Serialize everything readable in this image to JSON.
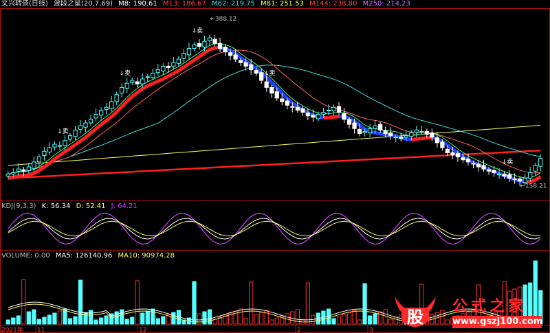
{
  "header": {
    "title": "文兴转债(日线)",
    "indicator": "波段之星(20,7,69)",
    "ma": [
      {
        "label": "M8: 190.61",
        "color": "#ffffff"
      },
      {
        "label": "M13: 186.67",
        "color": "#ff4040"
      },
      {
        "label": "M62: 219.75",
        "color": "#40e0e0"
      },
      {
        "label": "M81: 251.53",
        "color": "#ffff50"
      },
      {
        "label": "M144: 238.80",
        "color": "#ff4040"
      },
      {
        "label": "M250: 214.23",
        "color": "#d070ff"
      }
    ]
  },
  "kdj_header": {
    "name": "KDJ(9,3,3)",
    "k": "K: 56.34",
    "d": "D: 52.41",
    "j": "J: 64.21"
  },
  "volume_header": {
    "name": "VOLUME: 0.00",
    "ma5": "MA5: 126140.96",
    "ma10": "MA10: 90974.28"
  },
  "annotations": {
    "sell": "↓卖",
    "high": "←388.12",
    "low": "←158.21"
  },
  "date_labels": [
    "2021年",
    "11",
    "12",
    "2",
    "3"
  ],
  "watermark": {
    "logo_char": "股",
    "text": "公式之家",
    "url": "www.gszj100.com"
  },
  "colors": {
    "up": "#54ffff",
    "down": "#ffffff",
    "grid": "#b01010",
    "ribbon_up": "#ff2020",
    "ribbon_down": "#2040ff",
    "k": "#ffffff",
    "d": "#ffff60",
    "j": "#d040ff"
  },
  "chart_data": {
    "type": "candlestick",
    "title": "文兴转债(日线)",
    "series_close": [
      168,
      170,
      175,
      172,
      178,
      185,
      192,
      200,
      205,
      210,
      208,
      215,
      222,
      230,
      236,
      240,
      245,
      252,
      258,
      262,
      270,
      280,
      290,
      296,
      300,
      295,
      302,
      305,
      310,
      315,
      320,
      318,
      325,
      330,
      338,
      345,
      350,
      348,
      355,
      360,
      352,
      345,
      340,
      335,
      330,
      325,
      320,
      315,
      310,
      300,
      290,
      282,
      275,
      270,
      265,
      262,
      258,
      255,
      250,
      248,
      252,
      255,
      258,
      262,
      255,
      245,
      238,
      232,
      225,
      228,
      232,
      236,
      230,
      225,
      222,
      220,
      218,
      222,
      226,
      230,
      228,
      224,
      220,
      212,
      205,
      198,
      195,
      192,
      188,
      185,
      182,
      178,
      175,
      172,
      170,
      168,
      165,
      162,
      160,
      158,
      162,
      170,
      180,
      190
    ],
    "high_annotation": 388.12,
    "low_annotation": 158.21,
    "kdj": {
      "K": 56.34,
      "D": 52.41,
      "J": 64.21
    },
    "volume": {
      "current": 0.0,
      "MA5": 126140.96,
      "MA10": 90974.28
    }
  }
}
